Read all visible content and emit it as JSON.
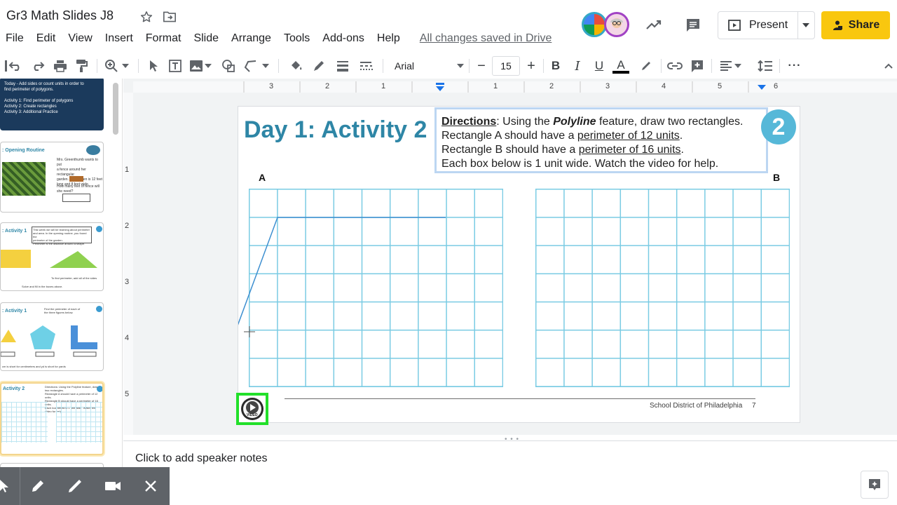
{
  "header": {
    "title": "Gr3 Math Slides J8",
    "saved_status": "All changes saved in Drive",
    "present_label": "Present",
    "share_label": "Share",
    "share_color": "#f9c70f"
  },
  "menu": {
    "items": [
      "File",
      "Edit",
      "View",
      "Insert",
      "Format",
      "Slide",
      "Arrange",
      "Tools",
      "Add-ons",
      "Help"
    ]
  },
  "toolbar": {
    "font": "Arial",
    "font_size": "15",
    "minus": "−",
    "plus": "+",
    "bold": "B",
    "italic": "I",
    "underline": "U",
    "text_color": "A",
    "more": "···"
  },
  "ruler": {
    "horizontal": [
      "3",
      "2",
      "1",
      "1",
      "2",
      "3",
      "4",
      "5",
      "6"
    ],
    "vertical": [
      "1",
      "2",
      "3",
      "4",
      "5"
    ]
  },
  "filmstrip": {
    "thumbs": [
      {
        "title": "",
        "lines": [
          "Today - Add sides or count units in order to",
          "find perimeter of polygons.",
          "Activity 1: Find perimeter of polygons",
          "Activity 2: Create rectangles",
          "Activity 3: Additional Practice"
        ]
      },
      {
        "title": ": Opening Routine",
        "lines": [
          "Mrs. Greenthumb wants to put",
          "a fence around her rectangular",
          "garden. Her garden is 12 feet",
          "long and 8 feet wide.",
          "How many feet of fence will",
          "she need?"
        ]
      },
      {
        "title": ": Activity 1",
        "lines": [
          "This week we will be learning about perimeter",
          "and area. In the opening routine, you found the",
          "perimeter of the garden.",
          "Perimeter is the distance around a shape.",
          "To find perimeter, add all of the sides",
          "Solve and fill in the boxes above."
        ]
      },
      {
        "title": ": Activity 1",
        "lines": [
          "Find the perimeter of each of",
          "the three figures below.",
          "cm is short for centimeters and yd is short for yards"
        ]
      },
      {
        "title": "Activity 2",
        "lines": [
          "Directions: Using the Polyline feature, draw two rectangles.",
          "Rectangle A should have a perimeter of 12 units.",
          "Rectangle B should have a perimeter of 16 units.",
          "Each box below is 1 unit wide. Watch the video for help."
        ]
      }
    ]
  },
  "slide": {
    "title": "Day 1: Activity 2",
    "directions": {
      "heading": "Directions",
      "line1_pre": ": Using the ",
      "line1_bold": "Polyline",
      "line1_post": " feature, draw two rectangles.",
      "line2_pre": "Rectangle A should have a ",
      "line2_u": "perimeter of 12 units",
      "line2_post": ".",
      "line3_pre": "Rectangle B should have a ",
      "line3_u": "perimeter of 16 units",
      "line3_post": ".",
      "line4": "Each box below is 1 unit wide. Watch the video for help."
    },
    "badge": "2",
    "grid_a_label": "A",
    "grid_b_label": "B",
    "footer": "School District of Philadelphia",
    "page_number": "7",
    "video_label": "VIDEO",
    "accent": "#2e86a6",
    "grid_color": "#79cbe3",
    "video_border": "#22e02a"
  },
  "notes": {
    "placeholder": "Click to add speaker notes"
  }
}
